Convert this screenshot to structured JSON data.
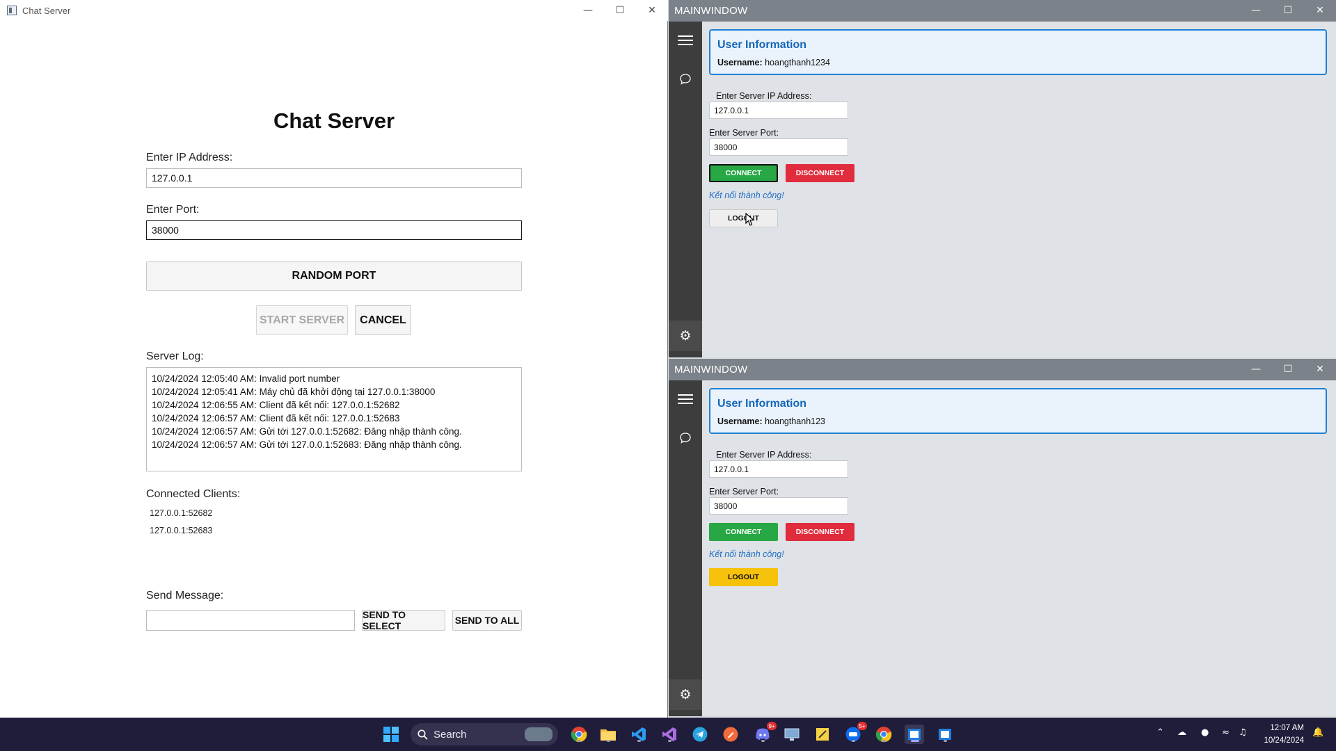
{
  "server": {
    "window_title": "Chat Server",
    "heading": "Chat Server",
    "ip_label": "Enter IP Address:",
    "ip_value": "127.0.0.1",
    "port_label": "Enter Port:",
    "port_value": "38000",
    "random_port_label": "RANDOM PORT",
    "start_server_label": "START SERVER",
    "cancel_label": "CANCEL",
    "log_label": "Server Log:",
    "log_lines": [
      "10/24/2024 12:05:40 AM: Invalid port number",
      "10/24/2024 12:05:41 AM: Máy chủ đã khởi động tại 127.0.0.1:38000",
      "10/24/2024 12:06:55 AM: Client đã kết nối: 127.0.0.1:52682",
      "10/24/2024 12:06:57 AM: Client đã kết nối: 127.0.0.1:52683",
      "10/24/2024 12:06:57 AM: Gửi tới 127.0.0.1:52682: Đăng nhập thành công.",
      "10/24/2024 12:06:57 AM: Gửi tới 127.0.0.1:52683: Đăng nhập thành công."
    ],
    "clients_label": "Connected Clients:",
    "clients": [
      "127.0.0.1:52682",
      "127.0.0.1:52683"
    ],
    "send_label": "Send Message:",
    "send_value": "",
    "send_to_select_label": "SEND TO SELECT",
    "send_to_all_label": "SEND TO ALL"
  },
  "clients": [
    {
      "window_title": "MAINWINDOW",
      "card_title": "User Information",
      "username_label": "Username:",
      "username": "hoangthanh1234",
      "ip_label": "Enter Server IP Address:",
      "ip_value": "127.0.0.1",
      "port_label": "Enter Server Port:",
      "port_value": "38000",
      "connect_label": "CONNECT",
      "disconnect_label": "DISCONNECT",
      "status": "Kết nối thành công!",
      "logout_label": "LOGOUT"
    },
    {
      "window_title": "MAINWINDOW",
      "card_title": "User Information",
      "username_label": "Username:",
      "username": "hoangthanh123",
      "ip_label": "Enter Server IP Address:",
      "ip_value": "127.0.0.1",
      "port_label": "Enter Server Port:",
      "port_value": "38000",
      "connect_label": "CONNECT",
      "disconnect_label": "DISCONNECT",
      "status": "Kết nối thành công!",
      "logout_label": "LOGOUT"
    }
  ],
  "taskbar": {
    "search_label": "Search",
    "time": "12:07 AM",
    "date": "10/24/2024",
    "badges": {
      "discord": "9+",
      "zalo": "5+"
    },
    "icons": [
      "windows-start-icon",
      "search-icon",
      "chrome-icon",
      "file-explorer-icon",
      "vscode-icon",
      "visual-studio-icon",
      "telegram-icon",
      "postman-icon",
      "discord-icon",
      "remote-desktop-icon",
      "sticky-notes-icon",
      "zalo-icon",
      "chrome-profile-icon",
      "app-window-icon",
      "app-window-icon"
    ]
  },
  "colors": {
    "accent_blue": "#1e7fd4",
    "connect_green": "#27a844",
    "disconnect_red": "#e02c3d",
    "logout_yellow": "#f6c20b",
    "sidebar_dark": "#3d3d3d",
    "titlebar_gray": "#7c8289"
  }
}
